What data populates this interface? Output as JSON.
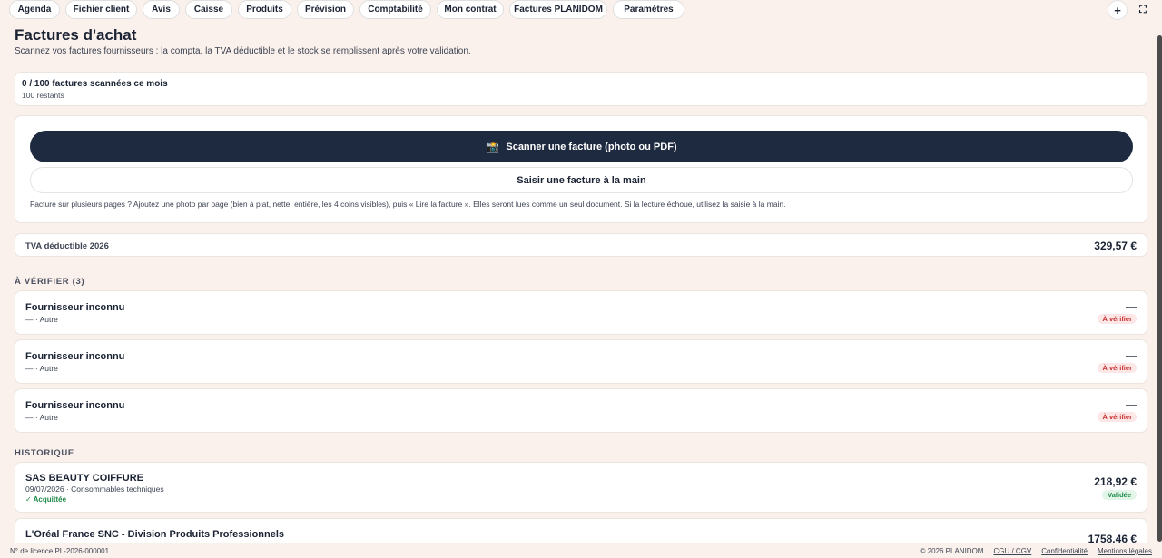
{
  "nav": {
    "tabs": [
      "Agenda",
      "Fichier client",
      "Avis",
      "Caisse",
      "Produits",
      "Prévision",
      "Comptabilité",
      "Mon contrat",
      "Factures PLANIDOM",
      "Paramètres"
    ],
    "add_symbol": "+",
    "expand_symbol": "⛶"
  },
  "header": {
    "title": "Factures d'achat",
    "subtitle": "Scannez vos factures fournisseurs : la compta, la TVA déductible et le stock se remplissent après votre validation."
  },
  "quota": {
    "main": "0 / 100 factures scannées ce mois",
    "sub": "100 restants"
  },
  "scan": {
    "camera_glyph": "📸",
    "scan_label": "Scanner une facture (photo ou PDF)",
    "manual_label": "Saisir une facture à la main",
    "help": "Facture sur plusieurs pages ? Ajoutez une photo par page (bien à plat, nette, entière, les 4 coins visibles), puis « Lire la facture ». Elles seront lues comme un seul document. Si la lecture échoue, utilisez la saisie à la main."
  },
  "tva": {
    "label": "TVA déductible 2026",
    "value": "329,57 €"
  },
  "to_verify": {
    "title": "À VÉRIFIER (3)",
    "items": [
      {
        "supplier": "Fournisseur inconnu",
        "meta": "— · Autre",
        "amount": "—",
        "badge": "À vérifier"
      },
      {
        "supplier": "Fournisseur inconnu",
        "meta": "— · Autre",
        "amount": "—",
        "badge": "À vérifier"
      },
      {
        "supplier": "Fournisseur inconnu",
        "meta": "— · Autre",
        "amount": "—",
        "badge": "À vérifier"
      }
    ]
  },
  "history": {
    "title": "HISTORIQUE",
    "items": [
      {
        "supplier": "SAS BEAUTY COIFFURE",
        "meta": "09/07/2026 · Consommables techniques",
        "paid": "✓ Acquittée",
        "amount": "218,92 €",
        "badge": "Validée"
      },
      {
        "supplier": "L'Oréal France SNC - Division Produits Professionnels",
        "amount": "1758,46 €"
      }
    ]
  },
  "footer": {
    "license": "N° de licence PL-2026-000001",
    "copyright": "© 2026 PLANIDOM",
    "links": [
      "CGU / CGV",
      "Confidentialité",
      "Mentions légales"
    ]
  },
  "colors": {
    "background": "#fbf1ec",
    "primary_button": "#1e2a40",
    "warning": "#c92d2d",
    "success": "#1f8a4a"
  }
}
